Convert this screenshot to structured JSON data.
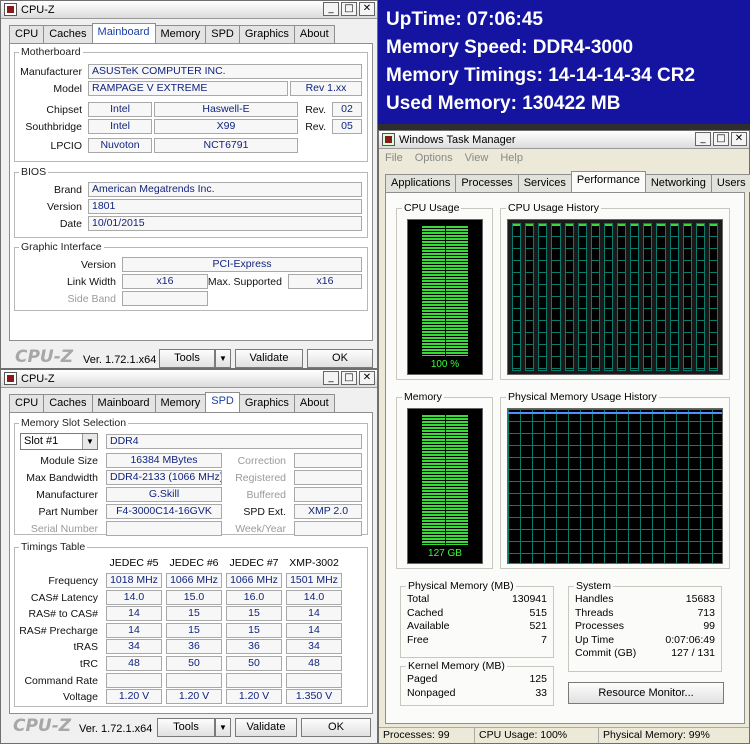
{
  "cpuz_title": "CPU-Z",
  "cpuz_tabs": [
    "CPU",
    "Caches",
    "Mainboard",
    "Memory",
    "SPD",
    "Graphics",
    "About"
  ],
  "mainboard": {
    "group_title": "Motherboard",
    "manufacturer_label": "Manufacturer",
    "manufacturer": "ASUSTeK COMPUTER INC.",
    "model_label": "Model",
    "model": "RAMPAGE V EXTREME",
    "model_rev": "Rev 1.xx",
    "chipset_label": "Chipset",
    "chipset_vendor": "Intel",
    "chipset_name": "Haswell-E",
    "rev_label": "Rev.",
    "chipset_rev": "02",
    "southbridge_label": "Southbridge",
    "south_vendor": "Intel",
    "south_name": "X99",
    "south_rev": "05",
    "lpcio_label": "LPCIO",
    "lpcio_vendor": "Nuvoton",
    "lpcio_name": "NCT6791",
    "bios_title": "BIOS",
    "brand_label": "Brand",
    "brand": "American Megatrends Inc.",
    "version_label": "Version",
    "version": "1801",
    "date_label": "Date",
    "date": "10/01/2015",
    "gi_title": "Graphic Interface",
    "gi_version_label": "Version",
    "gi_version": "PCI-Express",
    "link_width_label": "Link Width",
    "link_width": "x16",
    "max_supported_label": "Max. Supported",
    "max_supported": "x16",
    "side_band_label": "Side Band"
  },
  "spd": {
    "group_title": "Memory Slot Selection",
    "slot": "Slot #1",
    "type": "DDR4",
    "module_size_label": "Module Size",
    "module_size": "16384 MBytes",
    "correction_label": "Correction",
    "max_bw_label": "Max Bandwidth",
    "max_bw": "DDR4-2133 (1066 MHz)",
    "registered_label": "Registered",
    "manufacturer_label": "Manufacturer",
    "manufacturer": "G.Skill",
    "buffered_label": "Buffered",
    "part_label": "Part Number",
    "part": "F4-3000C14-16GVK",
    "spd_ext_label": "SPD Ext.",
    "spd_ext": "XMP 2.0",
    "serial_label": "Serial Number",
    "week_label": "Week/Year",
    "timings_title": "Timings Table",
    "columns": [
      "JEDEC #5",
      "JEDEC #6",
      "JEDEC #7",
      "XMP-3002"
    ],
    "rows": [
      {
        "label": "Frequency",
        "values": [
          "1018 MHz",
          "1066 MHz",
          "1066 MHz",
          "1501 MHz"
        ]
      },
      {
        "label": "CAS# Latency",
        "values": [
          "14.0",
          "15.0",
          "16.0",
          "14.0"
        ]
      },
      {
        "label": "RAS# to CAS#",
        "values": [
          "14",
          "15",
          "15",
          "14"
        ]
      },
      {
        "label": "RAS# Precharge",
        "values": [
          "14",
          "15",
          "15",
          "14"
        ]
      },
      {
        "label": "tRAS",
        "values": [
          "34",
          "36",
          "36",
          "34"
        ]
      },
      {
        "label": "tRC",
        "values": [
          "48",
          "50",
          "50",
          "48"
        ]
      },
      {
        "label": "Command Rate",
        "values": [
          "",
          "",
          "",
          ""
        ]
      },
      {
        "label": "Voltage",
        "values": [
          "1.20 V",
          "1.20 V",
          "1.20 V",
          "1.350 V"
        ]
      }
    ]
  },
  "cpuz_footer": {
    "logo": "CPU-Z",
    "version": "Ver. 1.72.1.x64",
    "tools": "Tools",
    "validate": "Validate",
    "ok": "OK"
  },
  "overlay": {
    "uptime": "UpTime: 07:06:45",
    "mem_speed": "Memory Speed: DDR4-3000",
    "mem_timings": "Memory Timings: 14-14-14-34 CR2",
    "used_mem": "Used Memory: 130422 MB"
  },
  "taskmgr": {
    "title": "Windows Task Manager",
    "menu": [
      "File",
      "Options",
      "View",
      "Help"
    ],
    "tabs": [
      "Applications",
      "Processes",
      "Services",
      "Performance",
      "Networking",
      "Users"
    ],
    "cpu_usage_label": "CPU Usage",
    "cpu_usage": "100 %",
    "cpu_usage_fraction": 1.0,
    "cpu_history_label": "CPU Usage History",
    "memory_label": "Memory",
    "memory_value": "127 GB",
    "memory_fraction": 0.99,
    "pm_history_label": "Physical Memory Usage History",
    "phys_title": "Physical Memory (MB)",
    "phys": [
      [
        "Total",
        "130941"
      ],
      [
        "Cached",
        "515"
      ],
      [
        "Available",
        "521"
      ],
      [
        "Free",
        "7"
      ]
    ],
    "kernel_title": "Kernel Memory (MB)",
    "kernel": [
      [
        "Paged",
        "125"
      ],
      [
        "Nonpaged",
        "33"
      ]
    ],
    "system_title": "System",
    "system": [
      [
        "Handles",
        "15683"
      ],
      [
        "Threads",
        "713"
      ],
      [
        "Processes",
        "99"
      ],
      [
        "Up Time",
        "0:07:06:49"
      ],
      [
        "Commit (GB)",
        "127 / 131"
      ]
    ],
    "resource_monitor": "Resource Monitor...",
    "status": [
      "Processes: 99",
      "CPU Usage: 100%",
      "Physical Memory: 99%"
    ]
  }
}
